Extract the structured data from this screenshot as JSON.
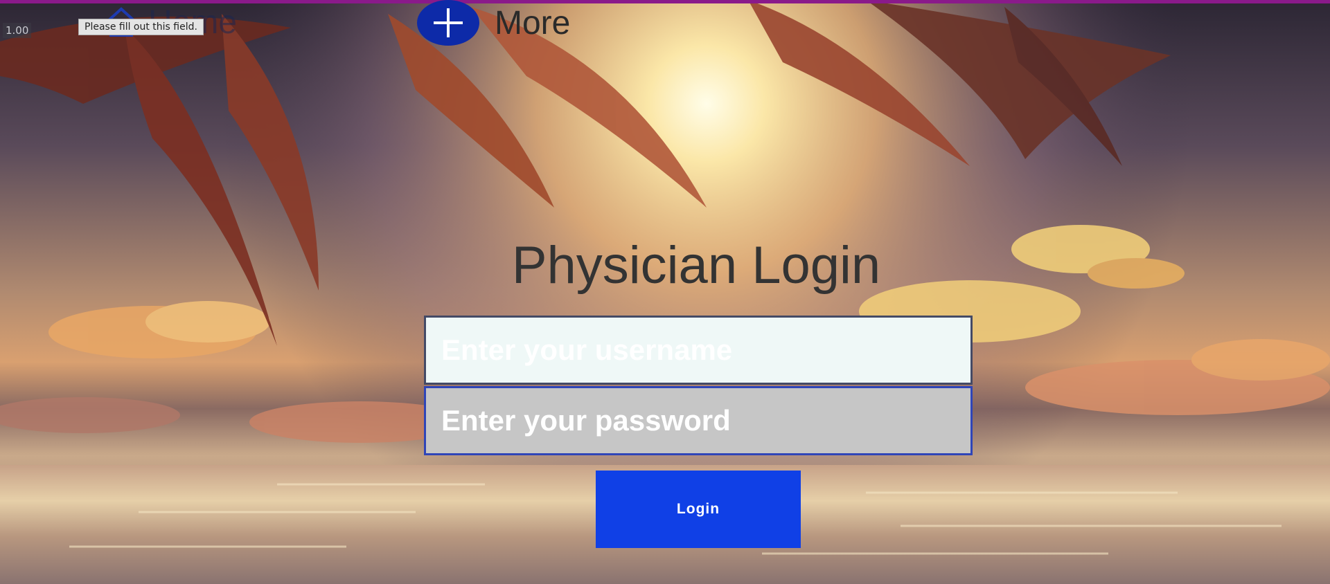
{
  "browser": {
    "zoom_readout": "1.00",
    "validation_tooltip": "Please fill out this field."
  },
  "nav": {
    "home_label": "Home",
    "home_icon": "home-icon",
    "more_label": "More",
    "more_icon": "plus-circle-icon"
  },
  "login": {
    "title": "Physician Login",
    "username_placeholder": "Enter your username",
    "password_placeholder": "Enter your password",
    "button_label": "Login"
  },
  "colors": {
    "accent_blue": "#1040e6",
    "more_icon_blue": "#0d2aa8",
    "top_bar": "#8a1a8a"
  }
}
